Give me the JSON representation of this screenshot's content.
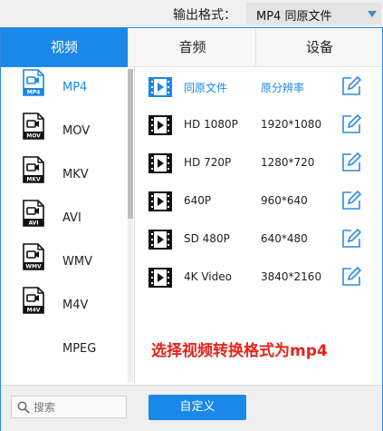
{
  "output_format": {
    "label": "输出格式：",
    "selected_value": "MP4  同原文件"
  },
  "tabs": [
    {
      "label": "视频",
      "active": true
    },
    {
      "label": "音频",
      "active": false
    },
    {
      "label": "设备",
      "active": false
    }
  ],
  "formats": [
    {
      "name": "MP4",
      "badge": "MP4",
      "selected": true
    },
    {
      "name": "MOV",
      "badge": "MOV",
      "selected": false
    },
    {
      "name": "MKV",
      "badge": "MKV",
      "selected": false
    },
    {
      "name": "AVI",
      "badge": "AVI",
      "selected": false
    },
    {
      "name": "WMV",
      "badge": "WMV",
      "selected": false
    },
    {
      "name": "M4V",
      "badge": "M4V",
      "selected": false
    },
    {
      "name": "MPEG",
      "badge": "",
      "selected": false
    }
  ],
  "presets": [
    {
      "name": "同原文件",
      "resolution": "原分辨率",
      "highlighted": true
    },
    {
      "name": "HD 1080P",
      "resolution": "1920*1080",
      "highlighted": false
    },
    {
      "name": "HD 720P",
      "resolution": "1280*720",
      "highlighted": false
    },
    {
      "name": "640P",
      "resolution": "960*640",
      "highlighted": false
    },
    {
      "name": "SD 480P",
      "resolution": "640*480",
      "highlighted": false
    },
    {
      "name": "4K Video",
      "resolution": "3840*2160",
      "highlighted": false
    }
  ],
  "annotation": "选择视频转换格式为mp4",
  "search": {
    "placeholder": "搜索"
  },
  "custom_button": "自定义",
  "colors": {
    "accent": "#1a88e8",
    "annotation": "#e8231a"
  },
  "icons": {
    "format": "video-file-icon",
    "preset": "film-strip-icon",
    "edit": "edit-icon",
    "search": "search-icon",
    "dropdown": "chevron-down-icon"
  }
}
